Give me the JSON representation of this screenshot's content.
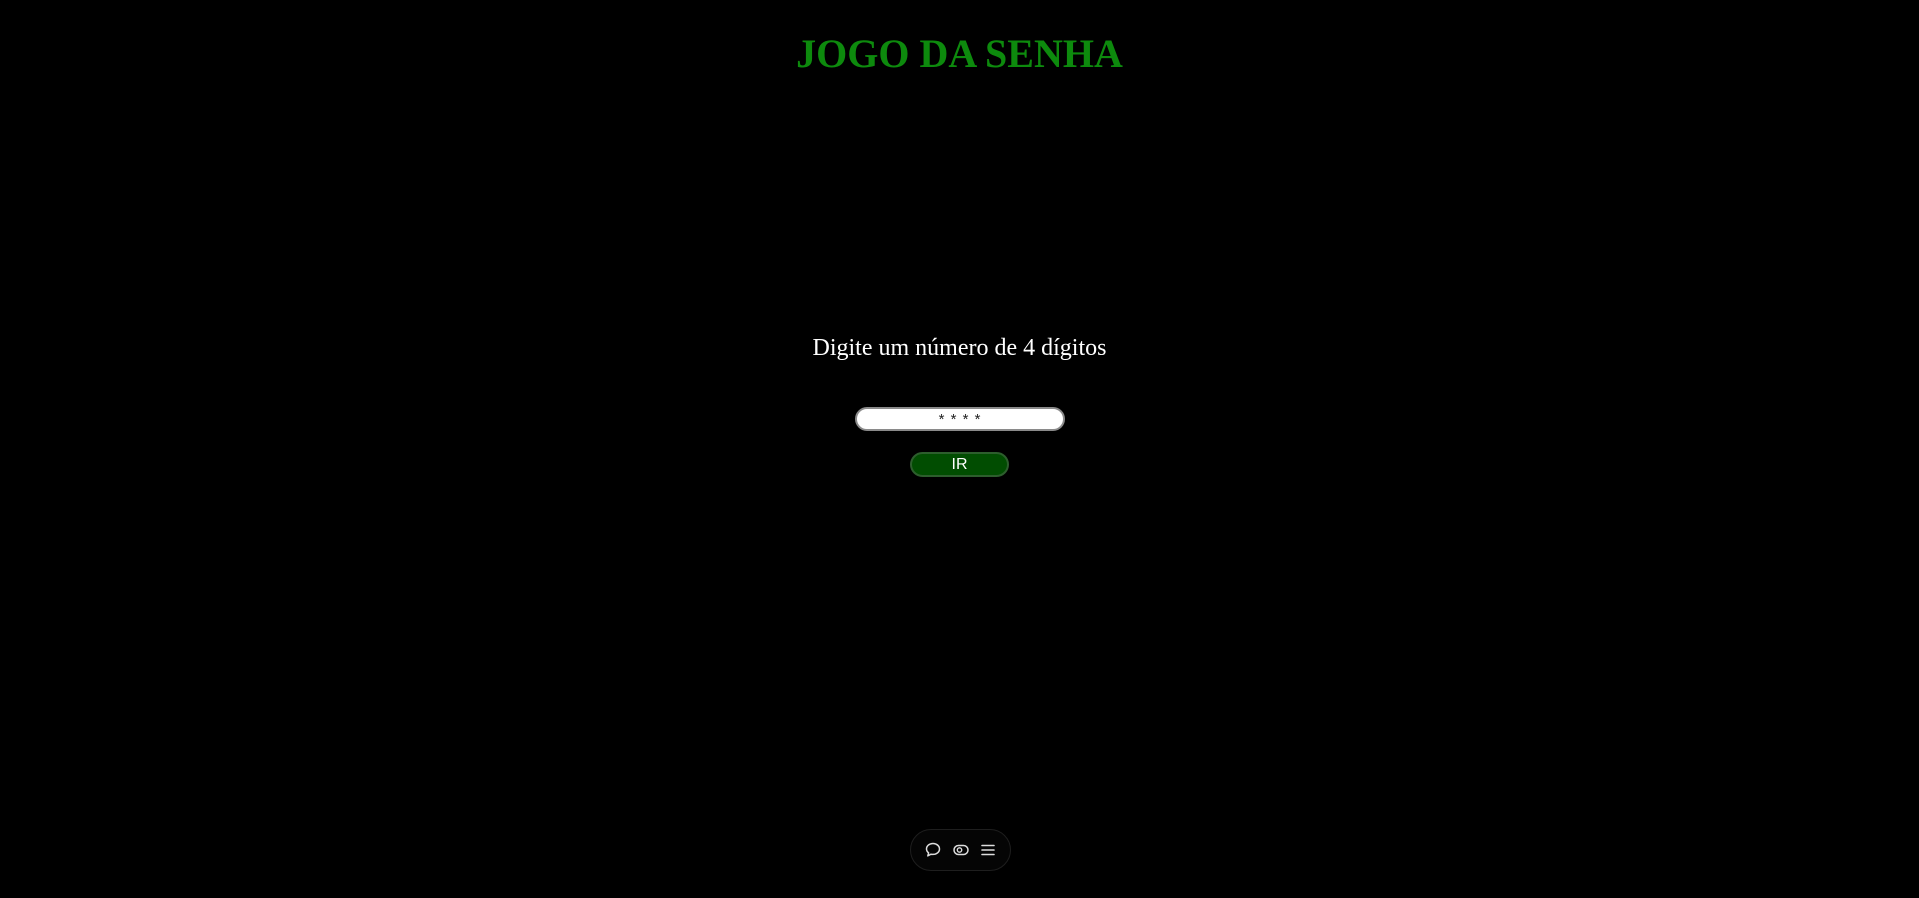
{
  "game": {
    "title": "JOGO DA SENHA",
    "prompt": "Digite um número de 4 dígitos",
    "input": {
      "placeholder": "* * * *",
      "value": ""
    },
    "submit_label": "IR"
  },
  "toolbar": {
    "items": [
      {
        "icon": "chat-bubble-icon"
      },
      {
        "icon": "eye-toggle-icon"
      },
      {
        "icon": "menu-icon"
      }
    ]
  },
  "colors": {
    "background": "#000000",
    "title": "#0d8a0d",
    "button": "#014d01",
    "text": "#ffffff"
  }
}
